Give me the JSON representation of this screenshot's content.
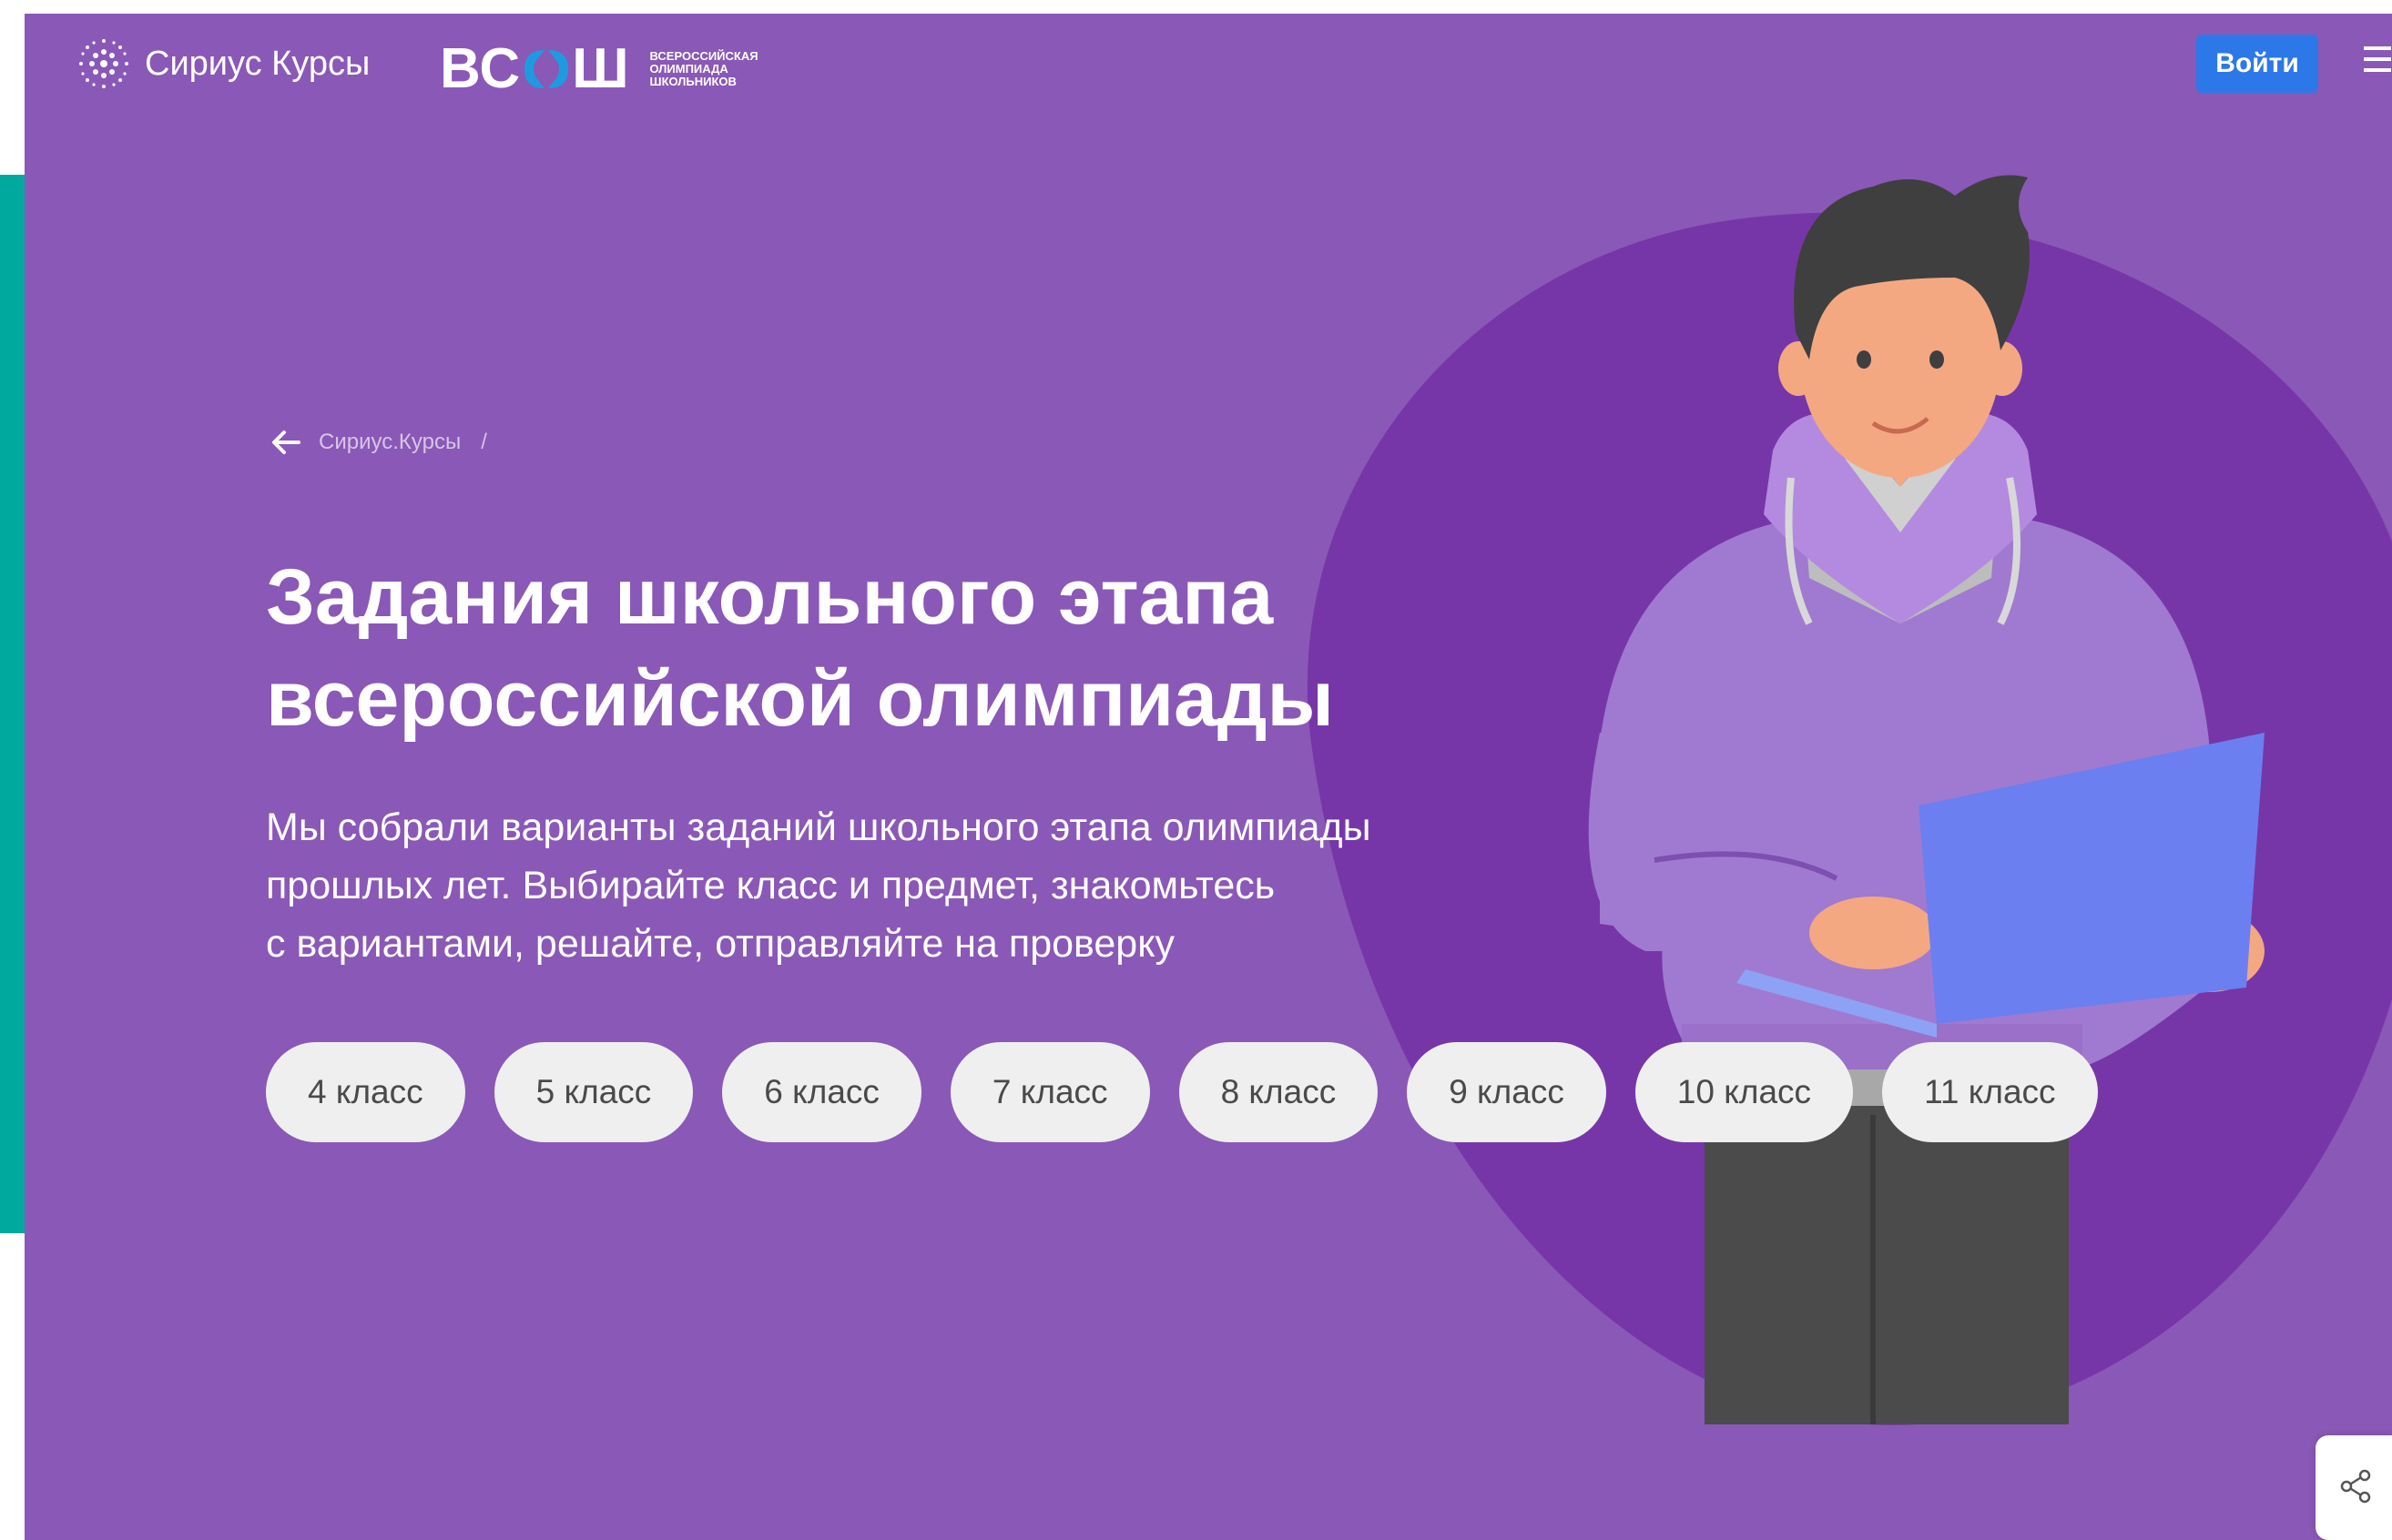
{
  "header": {
    "logo_text": "Сириус Курсы",
    "vsosh_abbr": "ВС",
    "vsosh_abbr_end": "Ш",
    "vsosh_full_line1": "всероссийская",
    "vsosh_full_line2": "олимпиада",
    "vsosh_full_line3": "школьников",
    "login_label": "Войти"
  },
  "breadcrumb": {
    "link": "Сириус.Курсы",
    "separator": "/"
  },
  "hero": {
    "title_line1": "Задания школьного этапа",
    "title_line2": "всероссийской олимпиады",
    "desc_line1": "Мы собрали варианты заданий школьного этапа олимпиады",
    "desc_line2": "прошлых лет. Выбирайте класс и предмет, знакомьтесь",
    "desc_line3": "с вариантами, решайте, отправляйте на проверку"
  },
  "grades": [
    "4 класс",
    "5 класс",
    "6 класс",
    "7 класс",
    "8 класс",
    "9 класс",
    "10 класс",
    "11 класс"
  ],
  "colors": {
    "hero_bg": "#8a58b6",
    "blob": "#7736a8",
    "login_button": "#2d78e8",
    "teal_strip": "#00a99d",
    "grade_pill": "#efefef"
  },
  "icons": {
    "logo": "sirius-dots-logo",
    "back": "arrow-left-icon",
    "menu": "hamburger-icon",
    "share": "share-icon"
  }
}
